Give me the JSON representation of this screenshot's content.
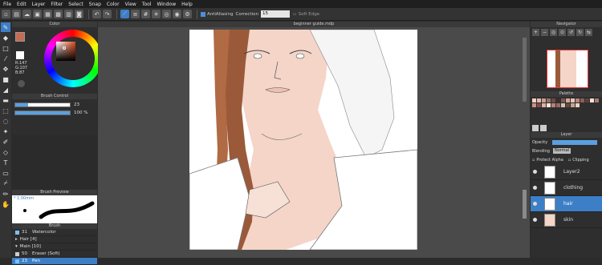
{
  "menu": [
    "File",
    "Edit",
    "Layer",
    "Filter",
    "Select",
    "Snap",
    "Color",
    "View",
    "Tool",
    "Window",
    "Help"
  ],
  "toolbar": {
    "antialias_label": "AntiAliasing",
    "correction_label": "Correction",
    "correction_value": "15",
    "soft_edge_label": "Soft Edge"
  },
  "color_panel": {
    "title": "Color",
    "fg_color": "#c66a54",
    "rgb": [
      "R:147",
      "G:107",
      "B:87"
    ]
  },
  "brush_control": {
    "title": "Brush Control",
    "size_value": "23",
    "opacity_value": "100 %",
    "size_fraction": 0.23,
    "opacity_fraction": 1.0
  },
  "brush_preview": {
    "title": "Brush Preview",
    "size_text": "* 1.00mm"
  },
  "brush": {
    "title": "Brush",
    "items": [
      {
        "size": "31",
        "label": "Watercolor",
        "type": "brush"
      },
      {
        "size": "",
        "label": "Hair [4]",
        "type": "group"
      },
      {
        "size": "",
        "label": "Main [10]",
        "type": "group"
      },
      {
        "size": "50",
        "label": "Eraser (Soft)",
        "type": "brush"
      },
      {
        "size": "23",
        "label": "Pen",
        "type": "brush",
        "selected": true
      }
    ]
  },
  "document": {
    "tab_title": "beginner guide.mdp"
  },
  "navigator": {
    "title": "Navigator"
  },
  "palette": {
    "title": "Palette",
    "colors": [
      "#f2d3c6",
      "#e7b9a9",
      "#caa092",
      "#9b7066",
      "#6b4b44",
      "#3b2b29",
      "#7a5a52",
      "#d9a896",
      "#e8c6b6",
      "#b3867a",
      "#8c6055",
      "#5c3f39",
      "#f0e0d8",
      "#a47c70",
      "#c49484",
      "#7c5048",
      "#e0b0a0",
      "#f8e8e0",
      "#b48478",
      "#946c60",
      "#d8c0b4",
      "#684840",
      "#c8a094",
      "#e8d0c4"
    ]
  },
  "layer_panel": {
    "title": "Layer",
    "opacity_label": "Opacity",
    "blending_label": "Blending",
    "blending_value": "Normal",
    "protect_alpha_label": "Protect Alpha",
    "clipping_label": "Clipping",
    "layers": [
      {
        "name": "Layer2"
      },
      {
        "name": "clothing"
      },
      {
        "name": "hair",
        "selected": true
      },
      {
        "name": "skin"
      }
    ]
  }
}
